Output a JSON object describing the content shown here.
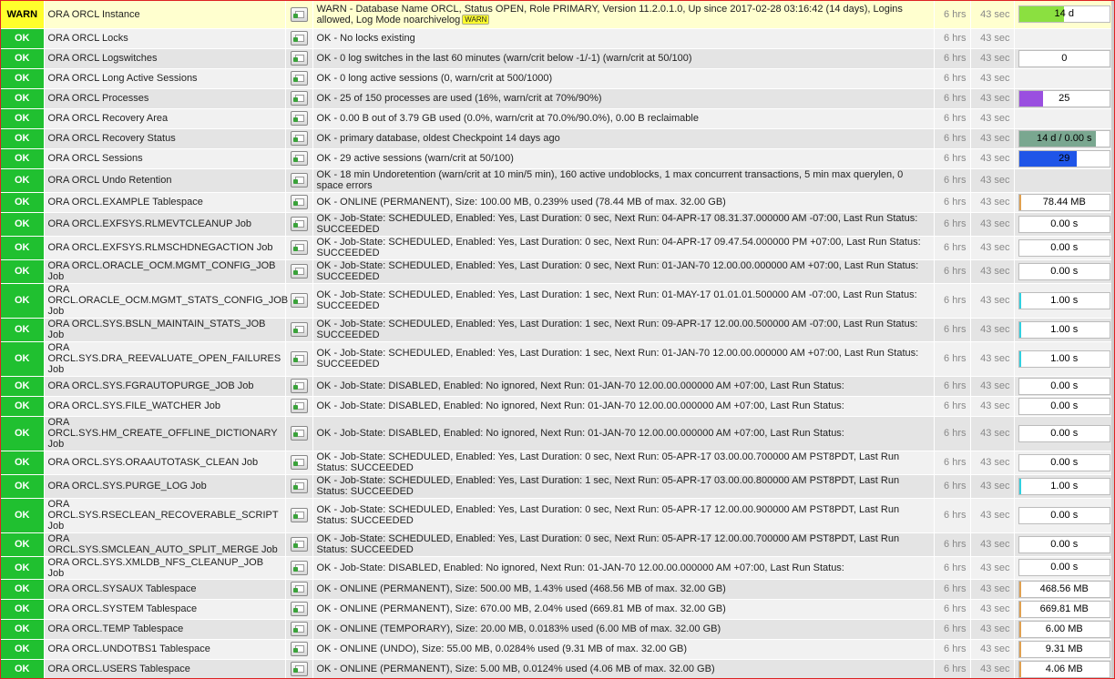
{
  "age_label": "6 hrs",
  "check_label": "43 sec",
  "badge_warn": "WARN",
  "rows": [
    {
      "state": "WARN",
      "name": "ORA ORCL Instance",
      "output": "WARN - Database Name ORCL, Status OPEN, Role PRIMARY, Version 11.2.0.1.0, Up since 2017-02-28 03:16:42 (14 days), Logins allowed, Log Mode noarchivelog",
      "badge": true,
      "perf": {
        "text": "14 d",
        "fill": 0.5,
        "color": "#8be040"
      }
    },
    {
      "state": "OK",
      "name": "ORA ORCL Locks",
      "output": "OK - No locks existing",
      "perf": null
    },
    {
      "state": "OK",
      "name": "ORA ORCL Logswitches",
      "output": "OK - 0 log switches in the last 60 minutes (warn/crit below -1/-1) (warn/crit at 50/100)",
      "perf": {
        "text": "0",
        "fill": 0,
        "color": "#2070e0"
      }
    },
    {
      "state": "OK",
      "name": "ORA ORCL Long Active Sessions",
      "output": "OK - 0 long active sessions (0, warn/crit at 500/1000)",
      "perf": null
    },
    {
      "state": "OK",
      "name": "ORA ORCL Processes",
      "output": "OK - 25 of 150 processes are used (16%, warn/crit at 70%/90%)",
      "perf": {
        "text": "25",
        "fill": 0.27,
        "color": "#9a4fe0"
      }
    },
    {
      "state": "OK",
      "name": "ORA ORCL Recovery Area",
      "output": "OK - 0.00 B out of 3.79 GB used (0.0%, warn/crit at 70.0%/90.0%), 0.00 B reclaimable",
      "perf": null
    },
    {
      "state": "OK",
      "name": "ORA ORCL Recovery Status",
      "output": "OK - primary database, oldest Checkpoint 14 days ago",
      "perf": {
        "text": "14 d / 0.00 s",
        "fill": 0.85,
        "color": "#7aa790"
      }
    },
    {
      "state": "OK",
      "name": "ORA ORCL Sessions",
      "output": "OK - 29 active sessions (warn/crit at 50/100)",
      "perf": {
        "text": "29",
        "fill": 0.64,
        "color": "#1f55e8"
      }
    },
    {
      "state": "OK",
      "name": "ORA ORCL Undo Retention",
      "output": "OK - 18 min Undoretention (warn/crit at 10 min/5 min), 160 active undoblocks, 1 max concurrent transactions, 5 min max querylen, 0 space errors",
      "perf": null
    },
    {
      "state": "OK",
      "name": "ORA ORCL.EXAMPLE Tablespace",
      "output": "OK - ONLINE (PERMANENT), Size: 100.00 MB, 0.239% used (78.44 MB of max. 32.00 GB)",
      "perf": {
        "text": "78.44 MB",
        "fill": 0.02,
        "color": "#e0a050"
      }
    },
    {
      "state": "OK",
      "name": "ORA ORCL.EXFSYS.RLMEVTCLEANUP Job",
      "output": "OK - Job-State: SCHEDULED, Enabled: Yes, Last Duration: 0 sec, Next Run: 04-APR-17 08.31.37.000000 AM -07:00, Last Run Status: SUCCEEDED",
      "perf": {
        "text": "0.00 s",
        "fill": 0,
        "color": "#30d0e0"
      }
    },
    {
      "state": "OK",
      "name": "ORA ORCL.EXFSYS.RLMSCHDNEGACTION Job",
      "output": "OK - Job-State: SCHEDULED, Enabled: Yes, Last Duration: 0 sec, Next Run: 04-APR-17 09.47.54.000000 PM +07:00, Last Run Status: SUCCEEDED",
      "perf": {
        "text": "0.00 s",
        "fill": 0,
        "color": "#30d0e0"
      }
    },
    {
      "state": "OK",
      "name": "ORA ORCL.ORACLE_OCM.MGMT_CONFIG_JOB Job",
      "output": "OK - Job-State: SCHEDULED, Enabled: Yes, Last Duration: 0 sec, Next Run: 01-JAN-70 12.00.00.000000 AM +07:00, Last Run Status: SUCCEEDED",
      "perf": {
        "text": "0.00 s",
        "fill": 0,
        "color": "#30d0e0"
      }
    },
    {
      "state": "OK",
      "name": "ORA ORCL.ORACLE_OCM.MGMT_STATS_CONFIG_JOB Job",
      "output": "OK - Job-State: SCHEDULED, Enabled: Yes, Last Duration: 1 sec, Next Run: 01-MAY-17 01.01.01.500000 AM -07:00, Last Run Status: SUCCEEDED",
      "perf": {
        "text": "1.00 s",
        "fill": 0.03,
        "color": "#30d0e0"
      }
    },
    {
      "state": "OK",
      "name": "ORA ORCL.SYS.BSLN_MAINTAIN_STATS_JOB Job",
      "output": "OK - Job-State: SCHEDULED, Enabled: Yes, Last Duration: 1 sec, Next Run: 09-APR-17 12.00.00.500000 AM -07:00, Last Run Status: SUCCEEDED",
      "perf": {
        "text": "1.00 s",
        "fill": 0.03,
        "color": "#30d0e0"
      }
    },
    {
      "state": "OK",
      "name": "ORA ORCL.SYS.DRA_REEVALUATE_OPEN_FAILURES Job",
      "output": "OK - Job-State: SCHEDULED, Enabled: Yes, Last Duration: 1 sec, Next Run: 01-JAN-70 12.00.00.000000 AM +07:00, Last Run Status: SUCCEEDED",
      "perf": {
        "text": "1.00 s",
        "fill": 0.03,
        "color": "#30d0e0"
      }
    },
    {
      "state": "OK",
      "name": "ORA ORCL.SYS.FGRAUTOPURGE_JOB Job",
      "output": "OK - Job-State: DISABLED, Enabled: No ignored, Next Run: 01-JAN-70 12.00.00.000000 AM +07:00, Last Run Status:",
      "perf": {
        "text": "0.00 s",
        "fill": 0,
        "color": "#30d0e0"
      }
    },
    {
      "state": "OK",
      "name": "ORA ORCL.SYS.FILE_WATCHER Job",
      "output": "OK - Job-State: DISABLED, Enabled: No ignored, Next Run: 01-JAN-70 12.00.00.000000 AM +07:00, Last Run Status:",
      "perf": {
        "text": "0.00 s",
        "fill": 0,
        "color": "#30d0e0"
      }
    },
    {
      "state": "OK",
      "name": "ORA ORCL.SYS.HM_CREATE_OFFLINE_DICTIONARY Job",
      "output": "OK - Job-State: DISABLED, Enabled: No ignored, Next Run: 01-JAN-70 12.00.00.000000 AM +07:00, Last Run Status:",
      "perf": {
        "text": "0.00 s",
        "fill": 0,
        "color": "#30d0e0"
      }
    },
    {
      "state": "OK",
      "name": "ORA ORCL.SYS.ORAAUTOTASK_CLEAN Job",
      "output": "OK - Job-State: SCHEDULED, Enabled: Yes, Last Duration: 0 sec, Next Run: 05-APR-17 03.00.00.700000 AM PST8PDT, Last Run Status: SUCCEEDED",
      "perf": {
        "text": "0.00 s",
        "fill": 0,
        "color": "#30d0e0"
      }
    },
    {
      "state": "OK",
      "name": "ORA ORCL.SYS.PURGE_LOG Job",
      "output": "OK - Job-State: SCHEDULED, Enabled: Yes, Last Duration: 1 sec, Next Run: 05-APR-17 03.00.00.800000 AM PST8PDT, Last Run Status: SUCCEEDED",
      "perf": {
        "text": "1.00 s",
        "fill": 0.03,
        "color": "#30d0e0"
      }
    },
    {
      "state": "OK",
      "name": "ORA ORCL.SYS.RSECLEAN_RECOVERABLE_SCRIPT Job",
      "output": "OK - Job-State: SCHEDULED, Enabled: Yes, Last Duration: 0 sec, Next Run: 05-APR-17 12.00.00.900000 AM PST8PDT, Last Run Status: SUCCEEDED",
      "perf": {
        "text": "0.00 s",
        "fill": 0,
        "color": "#30d0e0"
      }
    },
    {
      "state": "OK",
      "name": "ORA ORCL.SYS.SMCLEAN_AUTO_SPLIT_MERGE Job",
      "output": "OK - Job-State: SCHEDULED, Enabled: Yes, Last Duration: 0 sec, Next Run: 05-APR-17 12.00.00.700000 AM PST8PDT, Last Run Status: SUCCEEDED",
      "perf": {
        "text": "0.00 s",
        "fill": 0,
        "color": "#30d0e0"
      }
    },
    {
      "state": "OK",
      "name": "ORA ORCL.SYS.XMLDB_NFS_CLEANUP_JOB Job",
      "output": "OK - Job-State: DISABLED, Enabled: No ignored, Next Run: 01-JAN-70 12.00.00.000000 AM +07:00, Last Run Status:",
      "perf": {
        "text": "0.00 s",
        "fill": 0,
        "color": "#30d0e0"
      }
    },
    {
      "state": "OK",
      "name": "ORA ORCL.SYSAUX Tablespace",
      "output": "OK - ONLINE (PERMANENT), Size: 500.00 MB, 1.43% used (468.56 MB of max. 32.00 GB)",
      "perf": {
        "text": "468.56 MB",
        "fill": 0.02,
        "color": "#e0a050"
      }
    },
    {
      "state": "OK",
      "name": "ORA ORCL.SYSTEM Tablespace",
      "output": "OK - ONLINE (PERMANENT), Size: 670.00 MB, 2.04% used (669.81 MB of max. 32.00 GB)",
      "perf": {
        "text": "669.81 MB",
        "fill": 0.02,
        "color": "#e0a050"
      }
    },
    {
      "state": "OK",
      "name": "ORA ORCL.TEMP Tablespace",
      "output": "OK - ONLINE (TEMPORARY), Size: 20.00 MB, 0.0183% used (6.00 MB of max. 32.00 GB)",
      "perf": {
        "text": "6.00 MB",
        "fill": 0.02,
        "color": "#e0a050"
      }
    },
    {
      "state": "OK",
      "name": "ORA ORCL.UNDOTBS1 Tablespace",
      "output": "OK - ONLINE (UNDO), Size: 55.00 MB, 0.0284% used (9.31 MB of max. 32.00 GB)",
      "perf": {
        "text": "9.31 MB",
        "fill": 0.02,
        "color": "#e0a050"
      }
    },
    {
      "state": "OK",
      "name": "ORA ORCL.USERS Tablespace",
      "output": "OK - ONLINE (PERMANENT), Size: 5.00 MB, 0.0124% used (4.06 MB of max. 32.00 GB)",
      "perf": {
        "text": "4.06 MB",
        "fill": 0.02,
        "color": "#e0a050"
      }
    }
  ]
}
